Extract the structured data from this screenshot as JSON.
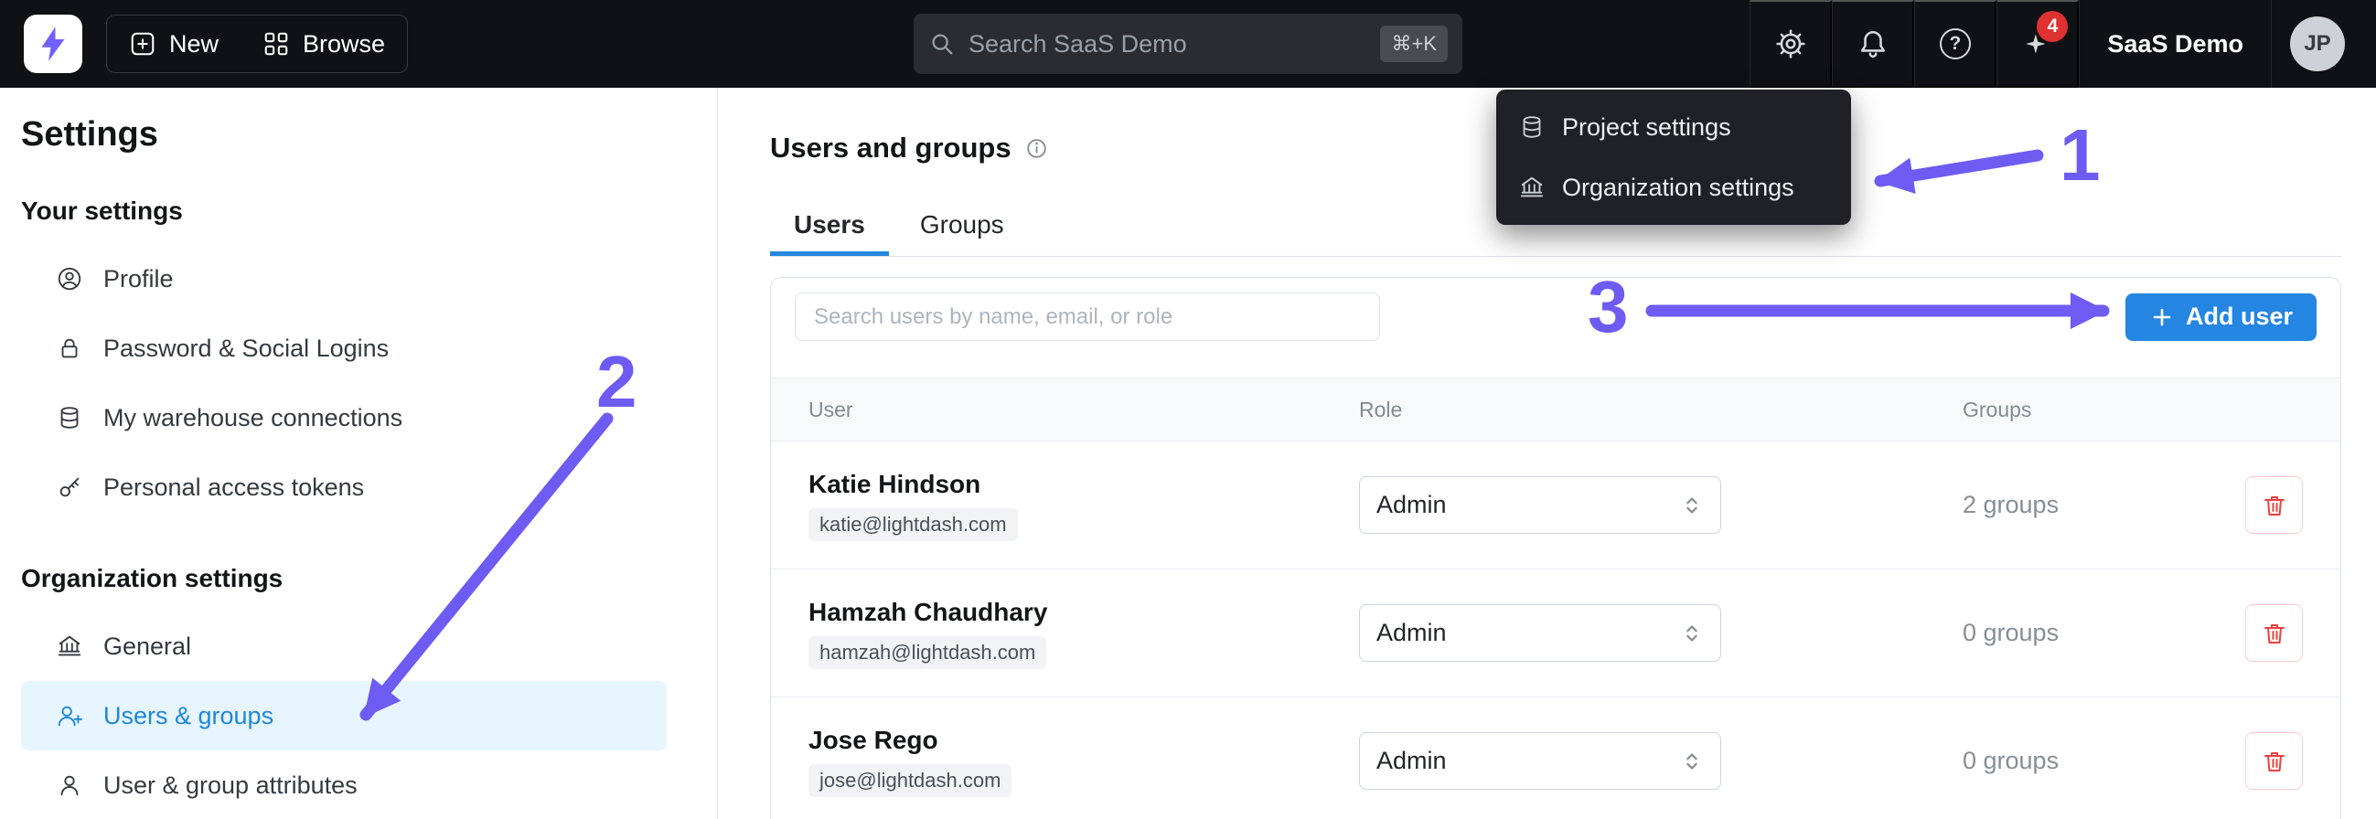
{
  "topbar": {
    "new_label": "New",
    "browse_label": "Browse",
    "search_placeholder": "Search SaaS Demo",
    "search_shortcut": "⌘+K",
    "notifications_count": "4",
    "org_name": "SaaS Demo",
    "avatar_initials": "JP"
  },
  "icons": {
    "help_glyph": "?"
  },
  "settings_menu": {
    "items": [
      {
        "label": "Project settings"
      },
      {
        "label": "Organization settings"
      }
    ]
  },
  "sidebar": {
    "title": "Settings",
    "sections": [
      {
        "heading": "Your settings",
        "items": [
          {
            "label": "Profile"
          },
          {
            "label": "Password & Social Logins"
          },
          {
            "label": "My warehouse connections"
          },
          {
            "label": "Personal access tokens"
          }
        ]
      },
      {
        "heading": "Organization settings",
        "items": [
          {
            "label": "General"
          },
          {
            "label": "Users & groups",
            "active": true
          },
          {
            "label": "User & group attributes"
          }
        ]
      }
    ]
  },
  "main": {
    "title": "Users and groups",
    "tabs": [
      {
        "label": "Users",
        "active": true
      },
      {
        "label": "Groups",
        "active": false
      }
    ],
    "search_placeholder": "Search users by name, email, or role",
    "add_user_label": "Add user",
    "table": {
      "columns": [
        "User",
        "Role",
        "Groups"
      ],
      "rows": [
        {
          "name": "Katie Hindson",
          "email": "katie@lightdash.com",
          "role": "Admin",
          "groups": "2 groups"
        },
        {
          "name": "Hamzah Chaudhary",
          "email": "hamzah@lightdash.com",
          "role": "Admin",
          "groups": "0 groups"
        },
        {
          "name": "Jose Rego",
          "email": "jose@lightdash.com",
          "role": "Admin",
          "groups": "0 groups"
        }
      ]
    }
  },
  "annotations": {
    "step1": "1",
    "step2": "2",
    "step3": "3"
  },
  "colors": {
    "accent": "#2486e0",
    "annotation": "#6e5bf2",
    "logo": "#7161ff",
    "badge": "#e03131",
    "active_bg": "#e7f5ff",
    "active_text": "#1f87d7"
  }
}
